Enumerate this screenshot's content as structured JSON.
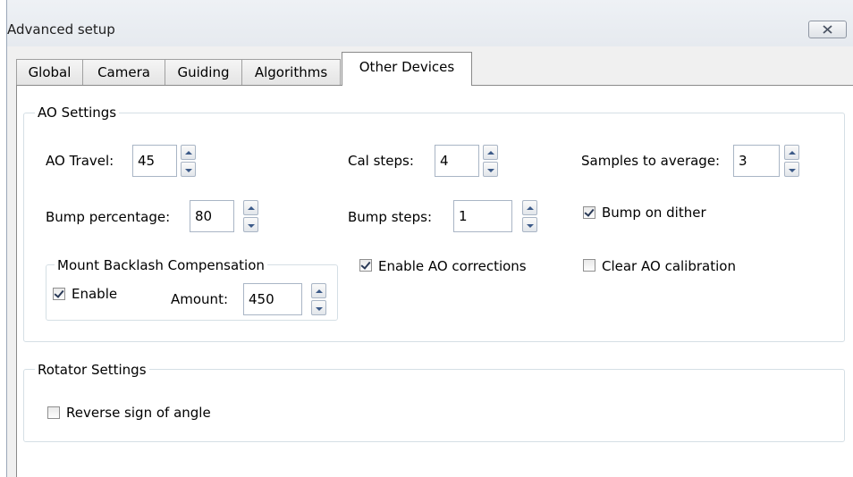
{
  "window": {
    "title": "Advanced setup"
  },
  "tabs": [
    "Global",
    "Camera",
    "Guiding",
    "Algorithms",
    "Other Devices"
  ],
  "active_tab": "Other Devices",
  "ao_settings": {
    "legend": "AO Settings",
    "ao_travel": {
      "label": "AO Travel:",
      "value": "45"
    },
    "cal_steps": {
      "label": "Cal steps:",
      "value": "4"
    },
    "samples_to_average": {
      "label": "Samples to average:",
      "value": "3"
    },
    "bump_percentage": {
      "label": "Bump percentage:",
      "value": "80"
    },
    "bump_steps": {
      "label": "Bump steps:",
      "value": "1"
    },
    "bump_on_dither": {
      "label": "Bump on dither",
      "checked": true
    },
    "enable_ao_corrections": {
      "label": "Enable AO corrections",
      "checked": true
    },
    "clear_ao_calibration": {
      "label": "Clear AO calibration",
      "checked": false
    },
    "mount_backlash": {
      "legend": "Mount Backlash Compensation",
      "enable": {
        "label": "Enable",
        "checked": true
      },
      "amount": {
        "label": "Amount:",
        "value": "450"
      }
    }
  },
  "rotator_settings": {
    "legend": "Rotator Settings",
    "reverse_sign": {
      "label": "Reverse sign of angle",
      "checked": false
    }
  },
  "icons": {
    "close": "close-x-icon",
    "spin_up": "arrow-up-icon",
    "spin_down": "arrow-down-icon"
  }
}
